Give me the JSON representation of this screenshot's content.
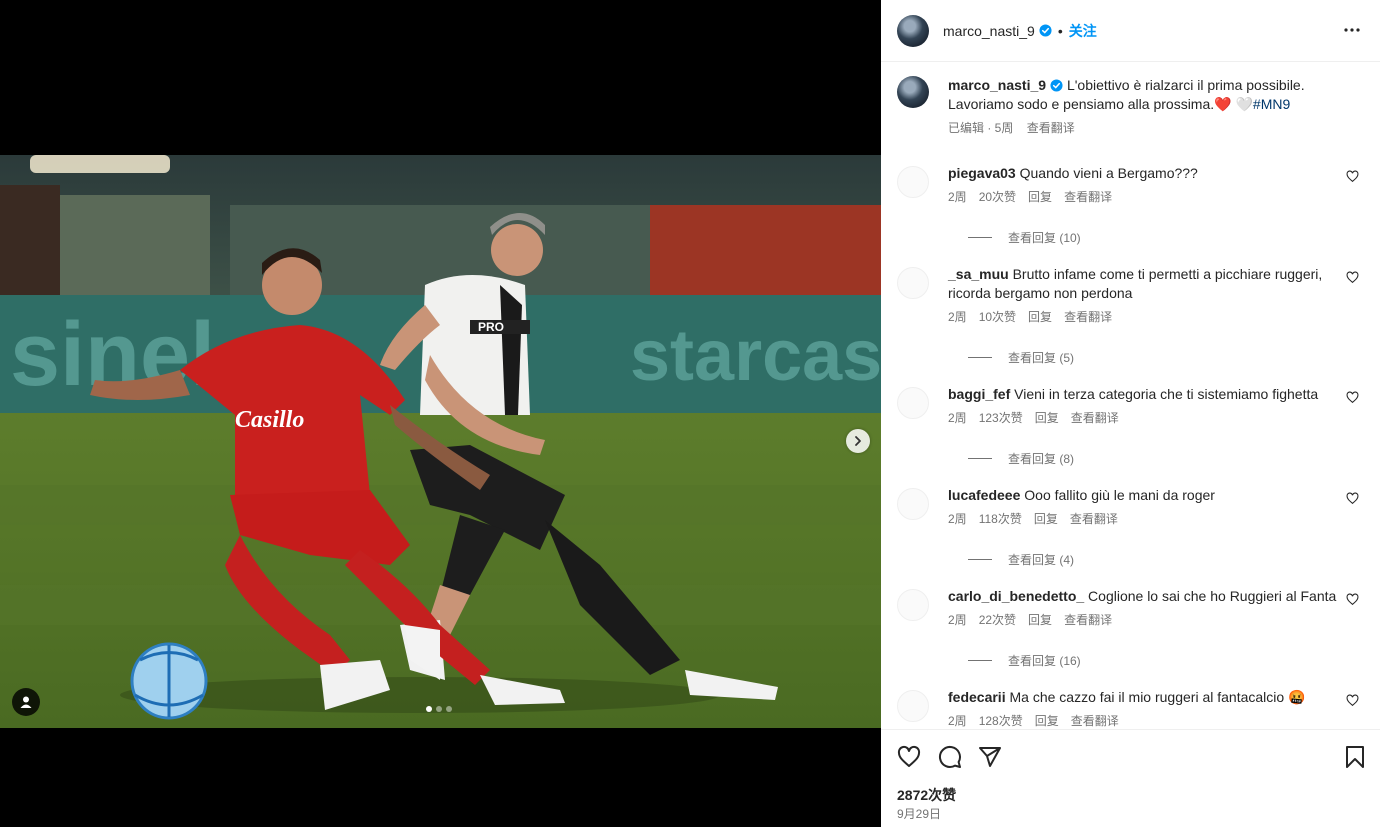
{
  "post": {
    "username": "marco_nasti_9",
    "follow_label": "关注",
    "caption_text": "L'obiettivo è rialzarci il prima possibile. Lavoriamo sodo e pensiamo alla prossima.",
    "caption_heart_red": "❤️",
    "caption_heart_white": "🤍",
    "caption_hashtag": "#MN9",
    "caption_edited": "已编辑 · 5周",
    "see_translation": "查看翻译",
    "likes": "2872次赞",
    "date": "9月29日"
  },
  "carousel": {
    "current": 1,
    "total": 3
  },
  "comments": [
    {
      "user": "piegava03",
      "text": "Quando vieni a Bergamo???",
      "age": "2周",
      "likes": "20次赞",
      "reply": "回复",
      "translate": "查看翻译",
      "replies": "查看回复 (10)"
    },
    {
      "user": "_sa_muu",
      "text": "Brutto infame come ti permetti a picchiare ruggeri, ricorda bergamo non perdona",
      "age": "2周",
      "likes": "10次赞",
      "reply": "回复",
      "translate": "查看翻译",
      "replies": "查看回复 (5)"
    },
    {
      "user": "baggi_fef",
      "text": "Vieni in terza categoria che ti sistemiamo fighetta",
      "age": "2周",
      "likes": "123次赞",
      "reply": "回复",
      "translate": "查看翻译",
      "replies": "查看回复 (8)"
    },
    {
      "user": "lucafedeee",
      "text": "Ooo fallito giù le mani da roger",
      "age": "2周",
      "likes": "118次赞",
      "reply": "回复",
      "translate": "查看翻译",
      "replies": "查看回复 (4)"
    },
    {
      "user": "carlo_di_benedetto_",
      "text": "Coglione lo sai che ho Ruggieri al Fanta",
      "age": "2周",
      "likes": "22次赞",
      "reply": "回复",
      "translate": "查看翻译",
      "replies": "查看回复 (16)"
    },
    {
      "user": "fedecarii",
      "text": "Ma che cazzo fai il mio ruggeri al fantacalcio 🤬",
      "age": "2周",
      "likes": "128次赞",
      "reply": "回复",
      "translate": "查看翻译",
      "replies": ""
    }
  ],
  "photo": {
    "ad_board_text_1": "sinel",
    "ad_board_text_2": "starcasin",
    "jersey_sponsor": "Casillo",
    "jersey_sponsor_2": "PRO"
  },
  "colors": {
    "accent": "#0095f6",
    "hashtag": "#00376b",
    "muted": "#737373"
  },
  "icons": [
    "more-icon",
    "verified-icon",
    "heart-icon",
    "comment-icon",
    "share-icon",
    "bookmark-icon",
    "chevron-right-icon",
    "user-tag-icon"
  ]
}
